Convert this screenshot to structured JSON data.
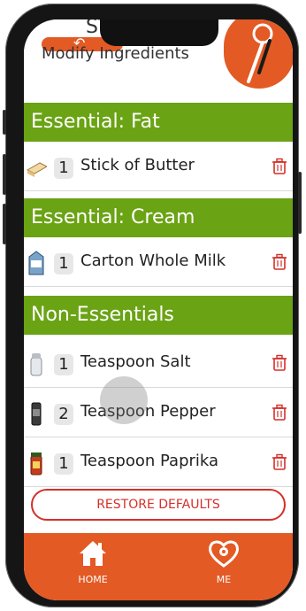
{
  "header": {
    "title_fragment": "ST",
    "subtitle": "Modify Ingredients"
  },
  "sections": [
    {
      "title": "Essential: Fat"
    },
    {
      "title": "Essential: Cream"
    },
    {
      "title": "Non-Essentials"
    }
  ],
  "items": [
    {
      "qty": "1",
      "name": "Stick of Butter",
      "icon": "butter-icon"
    },
    {
      "qty": "1",
      "name": "Carton Whole Milk",
      "icon": "milk-carton-icon"
    },
    {
      "qty": "1",
      "name": "Teaspoon Salt",
      "icon": "salt-shaker-icon"
    },
    {
      "qty": "2",
      "name": "Teaspoon Pepper",
      "icon": "pepper-grinder-icon"
    },
    {
      "qty": "1",
      "name": "Teaspoon Paprika",
      "icon": "paprika-jar-icon"
    }
  ],
  "actions": {
    "restore_defaults": "RESTORE DEFAULTS"
  },
  "nav": [
    {
      "label": "HOME",
      "icon": "home-icon"
    },
    {
      "label": "ME",
      "icon": "heart-gear-icon"
    }
  ],
  "colors": {
    "accent": "#e35a25",
    "section": "#6aa314",
    "danger": "#d4302a"
  }
}
